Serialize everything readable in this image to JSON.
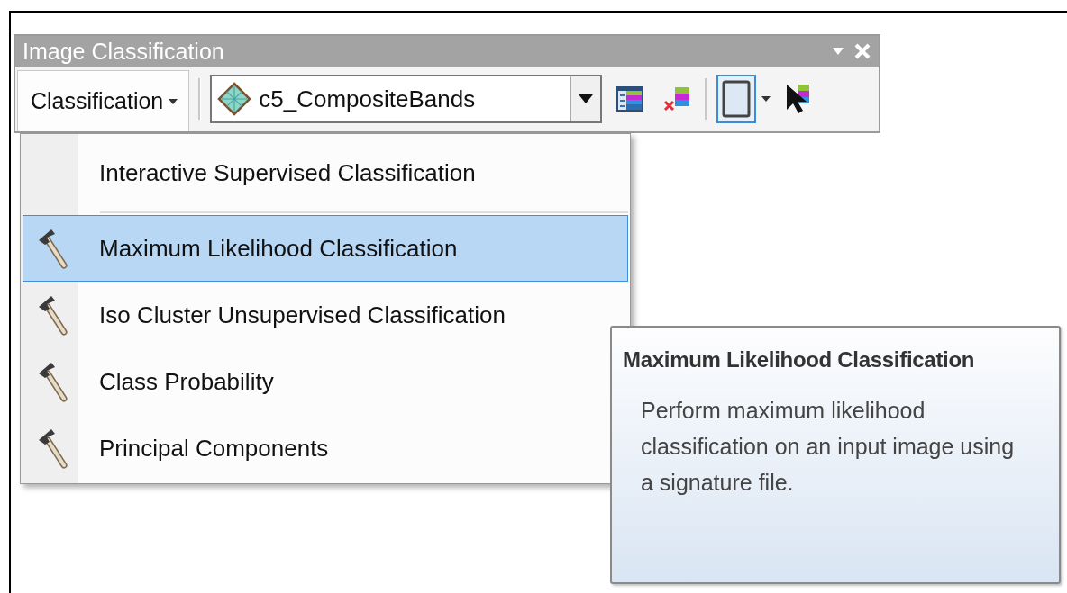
{
  "window": {
    "title": "Image Classification"
  },
  "toolbar": {
    "menu_button": "Classification",
    "layer_combo": {
      "value": "c5_CompositeBands"
    },
    "tools": [
      {
        "kind": "training-manager",
        "selected": false
      },
      {
        "kind": "clear-samples",
        "selected": false
      },
      {
        "kind": "rectangle",
        "selected": true
      },
      {
        "kind": "select",
        "selected": false
      }
    ]
  },
  "menu": {
    "items": [
      {
        "kind": "command",
        "label": "Interactive Supervised Classification",
        "selected": false
      },
      {
        "kind": "tool",
        "label": "Maximum Likelihood Classification",
        "selected": true
      },
      {
        "kind": "tool",
        "label": "Iso Cluster Unsupervised Classification",
        "selected": false
      },
      {
        "kind": "tool",
        "label": "Class Probability",
        "selected": false
      },
      {
        "kind": "tool",
        "label": "Principal Components",
        "selected": false
      }
    ]
  },
  "tooltip": {
    "title": "Maximum Likelihood Classification",
    "text": "Perform maximum likelihood classification on an input image using a signature file."
  }
}
